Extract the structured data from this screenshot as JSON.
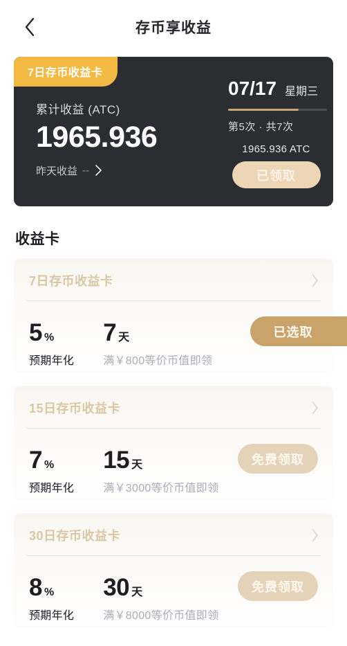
{
  "header": {
    "back_icon": "chevron-left-icon",
    "title": "存币享收益"
  },
  "summary": {
    "badge_label": "7日存币收益卡",
    "total_label": "累计收益 (ATC)",
    "total_amount": "1965.936",
    "yesterday_label": "昨天收益",
    "yesterday_value": "--",
    "yesterday_chevron": "chevron-right-icon",
    "date": "07/17",
    "weekday": "星期三",
    "progress_percent": 71,
    "progress_fill_color": "#c6a877",
    "progress_track_color": "#4c4d53",
    "count_text": "第5次 · 共7次",
    "reward_amount": "1965.936 ATC",
    "claim_button_label": "已领取",
    "card_bg_color": "#2c2d33",
    "badge_color": "#f3b942"
  },
  "section": {
    "title": "收益卡"
  },
  "cards": [
    {
      "title": "7日存币收益卡",
      "chevron_icon": "chevron-right-icon",
      "rate_value": "5",
      "rate_unit": "%",
      "rate_label": "预期年化",
      "term_value": "7",
      "term_unit": "天",
      "term_label": "满￥800等价币值即领",
      "action_label": "已选取",
      "action_state": "selected",
      "action_color": "#c9a36a"
    },
    {
      "title": "15日存币收益卡",
      "chevron_icon": "chevron-right-icon",
      "rate_value": "7",
      "rate_unit": "%",
      "rate_label": "预期年化",
      "term_value": "15",
      "term_unit": "天",
      "term_label": "满￥3000等价币值即领",
      "action_label": "免费领取",
      "action_state": "free",
      "action_color": "#e4d3b8"
    },
    {
      "title": "30日存币收益卡",
      "chevron_icon": "chevron-right-icon",
      "rate_value": "8",
      "rate_unit": "%",
      "rate_label": "预期年化",
      "term_value": "30",
      "term_unit": "天",
      "term_label": "满￥8000等价币值即领",
      "action_label": "免费领取",
      "action_state": "free",
      "action_color": "#e4d3b8"
    }
  ]
}
